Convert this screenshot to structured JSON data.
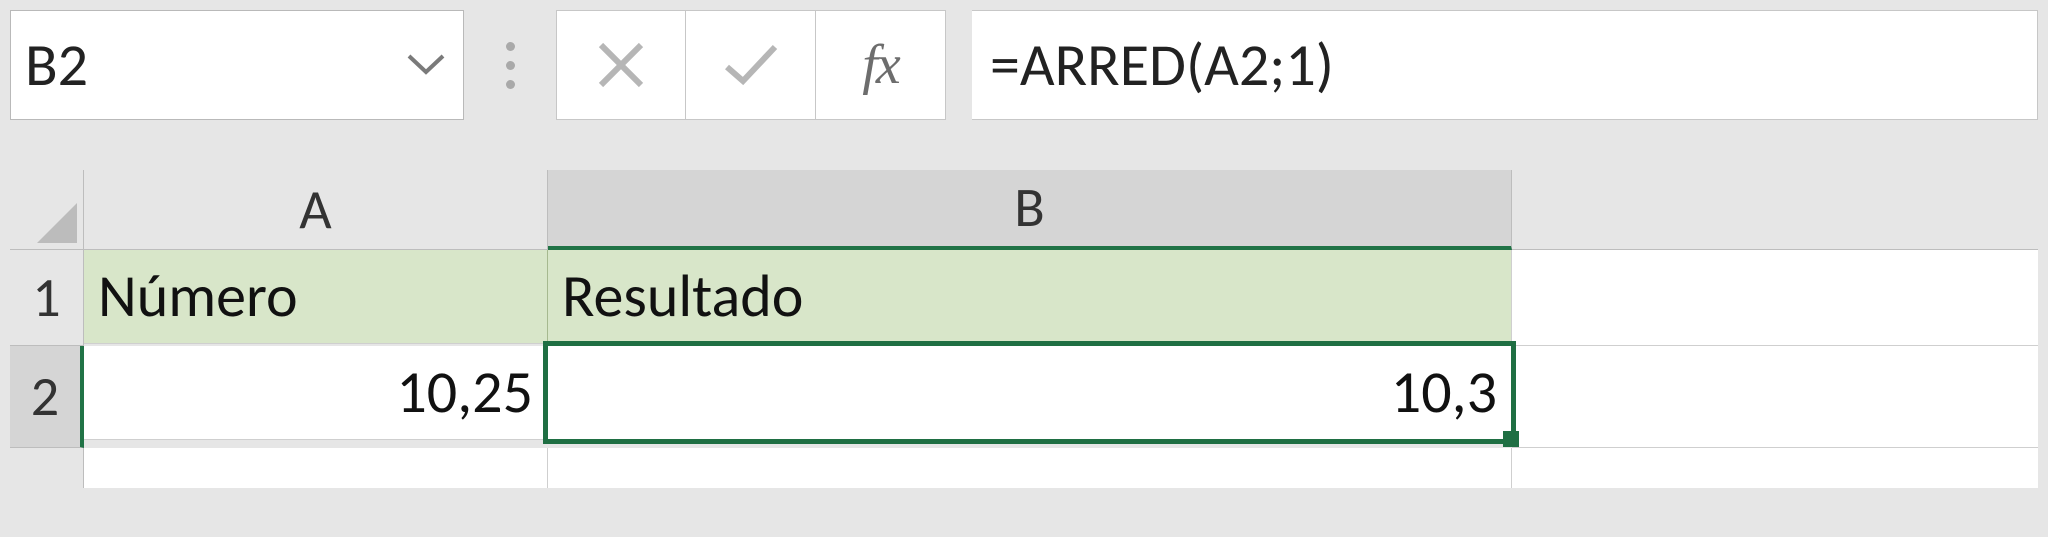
{
  "formula_bar": {
    "name_box": "B2",
    "cancel_icon": "cancel-icon",
    "enter_icon": "enter-icon",
    "fx_label": "fx",
    "formula": "=ARRED(A2;1)"
  },
  "columns": {
    "A": "A",
    "B": "B"
  },
  "rows": {
    "r1": "1",
    "r2": "2"
  },
  "cells": {
    "A1": "Número",
    "B1": "Resultado",
    "A2": "10,25",
    "B2": "10,3"
  },
  "selected_cell": "B2",
  "colors": {
    "selection_border": "#1f6f43",
    "header_fill": "#d8e6c9"
  }
}
